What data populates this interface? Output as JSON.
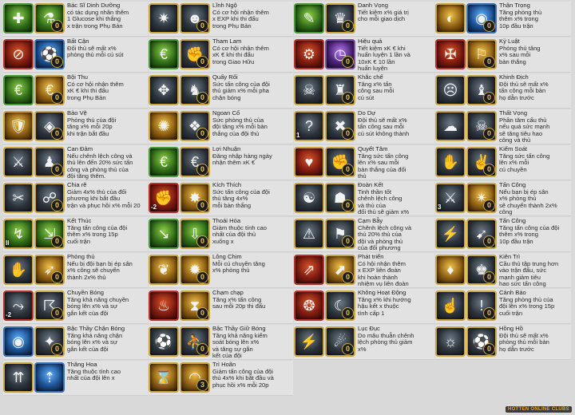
{
  "columns": [
    [
      {
        "name": "Bác Sĩ Dinh Dưỡng",
        "desc": "có tác dụng nhân thêm\n1 Glucose khi thắng\nx trận trong Phụ Bản",
        "icons": [
          {
            "id": "medicine-icon",
            "glyph": "✚",
            "frame": "green",
            "fill": "f-green"
          },
          {
            "id": "flask-icon",
            "glyph": "⚗",
            "frame": "gold",
            "fill": "f-green",
            "badge": "0"
          }
        ]
      },
      {
        "name": "Bất Cận",
        "desc": "Đối thủ sẽ mất x%\nphòng thủ mỗi cú sút",
        "icons": [
          {
            "id": "stop-ball-icon",
            "glyph": "⊘",
            "frame": "red",
            "fill": "f-red"
          },
          {
            "id": "ball-icon",
            "glyph": "⚽",
            "frame": "blue",
            "fill": "f-blue",
            "badge": "0"
          }
        ]
      },
      {
        "name": "Bội Thu",
        "desc": "Có cơ hội nhận thêm\nxK € khi thi đấu\ntrong Phụ Bản",
        "icons": [
          {
            "id": "money-bag-icon",
            "glyph": "€",
            "frame": "green",
            "fill": "f-green"
          },
          {
            "id": "coin-pile-icon",
            "glyph": "€",
            "frame": "gold",
            "fill": "f-gold",
            "badge": "0"
          }
        ]
      },
      {
        "name": "Bảo Vệ",
        "desc": "Phòng thủ của đội\ntăng x% mỗi 20p\nkhi trận bắt đầu",
        "icons": [
          {
            "id": "defender-icon",
            "glyph": "🛡",
            "frame": "gold",
            "fill": "f-gold"
          },
          {
            "id": "shield-player-icon",
            "glyph": "◈",
            "frame": "gold",
            "fill": "",
            "badge": "0"
          }
        ]
      },
      {
        "name": "Can Đảm",
        "desc": "Nếu chênh lệch công và\nthủ lên đến 20% sức tấn\ncông và phòng thủ của\nđội tăng thêm.",
        "icons": [
          {
            "id": "brave-player-icon",
            "glyph": "⚔",
            "frame": "gold",
            "fill": ""
          },
          {
            "id": "team-icon",
            "glyph": "♟",
            "frame": "gold",
            "fill": "",
            "badge": "0"
          }
        ]
      },
      {
        "name": "Chia rẽ",
        "desc": "Giảm 4x% thủ của đối\nphương khi bắt đầu\ntrận và phục hồi x% mỗi 20",
        "icons": [
          {
            "id": "split-icon",
            "glyph": "✂",
            "frame": "gold",
            "fill": ""
          },
          {
            "id": "divided-team-icon",
            "glyph": "☍",
            "frame": "gold",
            "fill": "",
            "badge": "0"
          }
        ]
      },
      {
        "name": "Kết Thúc",
        "desc": "Tăng tấn công của đội\nthêm x% trong 15p\ncuối trận",
        "icons": [
          {
            "id": "finish-icon",
            "glyph": "↯",
            "frame": "gold",
            "fill": "f-green",
            "side": "II"
          },
          {
            "id": "end-strike-icon",
            "glyph": "⇲",
            "frame": "gold",
            "fill": "f-green",
            "badge": "0"
          }
        ]
      },
      {
        "name": "Phòng thủ",
        "desc": "Nếu bị đội bạn bị ép sân\nx% công sẽ chuyển\nthành 2x% thủ",
        "icons": [
          {
            "id": "block-icon",
            "glyph": "✋",
            "frame": "gold",
            "fill": ""
          },
          {
            "id": "kick-icon",
            "glyph": "➶",
            "frame": "gold",
            "fill": "f-gold",
            "badge": "0"
          }
        ]
      },
      {
        "name": "Chuyền Bóng",
        "desc": "Tăng khả năng chuyền\nbóng lên x% và sự\ngắn kết của đội",
        "icons": [
          {
            "id": "pass-icon",
            "glyph": "⤳",
            "frame": "red",
            "fill": "",
            "side": "-2"
          },
          {
            "id": "passer-icon",
            "glyph": "☈",
            "frame": "gold",
            "fill": "",
            "badge": "0"
          }
        ]
      },
      {
        "name": "Bậc Thầy Chặn Bóng",
        "desc": "Tăng khả năng chặn\nbóng lên x% và sự\ngắn kết của đội",
        "icons": [
          {
            "id": "block-master-icon",
            "glyph": "◉",
            "frame": "blue",
            "fill": "f-blue"
          },
          {
            "id": "goalkeeper-icon",
            "glyph": "✦",
            "frame": "gold",
            "fill": "",
            "badge": "0"
          }
        ]
      },
      {
        "name": "Thăng Hoa",
        "desc": "Tăng thuộc tính cao\nnhất của đội lên x",
        "icons": [
          {
            "id": "ascend-icon",
            "glyph": "⇈",
            "frame": "gold",
            "fill": ""
          },
          {
            "id": "glowing-arrows-icon",
            "glyph": "⇡",
            "frame": "blue",
            "fill": "f-blue"
          }
        ]
      }
    ],
    [
      {
        "name": "Lĩnh Ngộ",
        "desc": "Có cơ hội nhận thêm\nx EXP khi thi đấu\ntrong Phụ Bản",
        "icons": [
          {
            "id": "insight-icon",
            "glyph": "✷",
            "frame": "gold",
            "fill": ""
          },
          {
            "id": "mind-icon",
            "glyph": "☻",
            "frame": "gold",
            "fill": "",
            "badge": "0"
          }
        ]
      },
      {
        "name": "Tham Lam",
        "desc": "Có cơ hội nhận thêm\nxK € khi thi đấu\ntrong Giao Hữu",
        "icons": [
          {
            "id": "greed-icon",
            "glyph": "€",
            "frame": "green",
            "fill": "f-green"
          },
          {
            "id": "grab-coin-icon",
            "glyph": "✊",
            "frame": "gold",
            "fill": "",
            "badge": "0"
          }
        ]
      },
      {
        "name": "Quấy Rối",
        "desc": "Sức tấn công của đội\nthủ giảm x% mỗi pha\nchặn bóng",
        "icons": [
          {
            "id": "harass-icon",
            "glyph": "✥",
            "frame": "gold",
            "fill": ""
          },
          {
            "id": "disrupt-icon",
            "glyph": "♞",
            "frame": "gold",
            "fill": "",
            "badge": "0"
          }
        ]
      },
      {
        "name": "Ngoan Cố",
        "desc": "Sức phòng thủ của\nđội tăng x% mỗi bàn\nthắng của đội thủ",
        "icons": [
          {
            "id": "stubborn-icon",
            "glyph": "✺",
            "frame": "gold",
            "fill": "f-gold"
          },
          {
            "id": "stubborn-player-icon",
            "glyph": "❖",
            "frame": "gold",
            "fill": "",
            "badge": "0"
          }
        ]
      },
      {
        "name": "Lợi Nhuận",
        "desc": "Đăng nhập hàng ngày\nnhận thêm xK €",
        "icons": [
          {
            "id": "profit-icon",
            "glyph": "€",
            "frame": "green",
            "fill": "f-green"
          },
          {
            "id": "profit-chart-icon",
            "glyph": "€",
            "frame": "gold",
            "fill": "",
            "badge": "0"
          }
        ]
      },
      {
        "name": "Kích Thích",
        "desc": "Sức tấn công của đội\nthủ tăng 4x%\nmỗi bàn thắng",
        "icons": [
          {
            "id": "fist-icon",
            "glyph": "✊",
            "frame": "red",
            "fill": "f-red",
            "side": "-2"
          },
          {
            "id": "stimulate-icon",
            "glyph": "✸",
            "frame": "gold",
            "fill": "f-gold",
            "badge": "0"
          }
        ]
      },
      {
        "name": "Thoái Hóa",
        "desc": "Giảm thuộc tính cao\nnhất của đội thủ\nxuống x",
        "icons": [
          {
            "id": "decay-icon",
            "glyph": "↘",
            "frame": "green",
            "fill": "f-green"
          },
          {
            "id": "downgrade-icon",
            "glyph": "⇩",
            "frame": "gold",
            "fill": "f-green",
            "badge": "0"
          }
        ]
      },
      {
        "name": "Lông Chim",
        "desc": "Mỗi cú chuyền tăng\nx% phòng thủ",
        "icons": [
          {
            "id": "feather-icon",
            "glyph": "❦",
            "frame": "gold",
            "fill": "f-gold"
          },
          {
            "id": "burst-icon",
            "glyph": "✹",
            "frame": "gold",
            "fill": "f-gold",
            "badge": "0"
          }
        ]
      },
      {
        "name": "Chạm chạp",
        "desc": "Tăng x% tấn công\nsau mỗi 20p thi đấu",
        "icons": [
          {
            "id": "slow-icon",
            "glyph": "♨",
            "frame": "red",
            "fill": "f-red"
          },
          {
            "id": "hourglass-icon",
            "glyph": "⧗",
            "frame": "gold",
            "fill": "f-gold",
            "badge": "0"
          }
        ]
      },
      {
        "name": "Bậc Thầy Giữ Bóng",
        "desc": "Tăng khả năng kiểm\nsoát bóng lên x%\nvà tăng sự gắn\nkết của đội",
        "icons": [
          {
            "id": "ball-control-icon",
            "glyph": "⚽",
            "frame": "gold",
            "fill": ""
          },
          {
            "id": "dribbler-icon",
            "glyph": "⛹",
            "frame": "gold",
            "fill": "",
            "badge": "0"
          }
        ]
      },
      {
        "name": "Trì Hoãn",
        "desc": "Giảm tấn công của đội\nthủ 4x% khi bắt đầu và\nphục hồi x% mỗi 20p",
        "icons": [
          {
            "id": "delay-icon",
            "glyph": "⌛",
            "frame": "gold",
            "fill": "f-gold"
          },
          {
            "id": "shell-icon",
            "glyph": "◠",
            "frame": "gold",
            "fill": "f-gold",
            "badge": "3"
          }
        ]
      }
    ],
    [
      {
        "name": "Danh Vọng",
        "desc": "Tiết kiệm x% giá trị\ncho mỗi giao dịch",
        "icons": [
          {
            "id": "fame-icon",
            "glyph": "✎",
            "frame": "green",
            "fill": "f-green"
          },
          {
            "id": "trophy-icon",
            "glyph": "♛",
            "frame": "gold",
            "fill": "",
            "badge": "0"
          }
        ]
      },
      {
        "name": "Hiệu quả",
        "desc": "Tiết kiệm xK € khi\nhuấn luyện 1 lần và\n10xK € 10 lần\nhuấn luyện",
        "icons": [
          {
            "id": "efficiency-icon",
            "glyph": "⚙",
            "frame": "red",
            "fill": "f-red"
          },
          {
            "id": "clock-icon",
            "glyph": "◷",
            "frame": "purple",
            "fill": "f-purple",
            "badge": "0"
          }
        ]
      },
      {
        "name": "Khắc chế",
        "desc": "Tăng x% tấn\ncông sau mỗi\ncú sút",
        "icons": [
          {
            "id": "counter-icon",
            "glyph": "☠",
            "frame": "gold",
            "fill": ""
          },
          {
            "id": "counter-player-icon",
            "glyph": "♜",
            "frame": "gold",
            "fill": "",
            "badge": "0"
          }
        ]
      },
      {
        "name": "Do Dự",
        "desc": "Đội thủ sẽ mất x%\ntấn công sau mỗi\ncú sút không thành",
        "icons": [
          {
            "id": "hesitate-icon",
            "glyph": "?",
            "frame": "gold",
            "fill": "",
            "side": "1"
          },
          {
            "id": "confused-icon",
            "glyph": "✖",
            "frame": "gold",
            "fill": "",
            "badge": "0"
          }
        ]
      },
      {
        "name": "Quyết Tâm",
        "desc": "Tăng sức tấn công\nlên x% sau mỗi\nbàn thắng của đối\nthủ",
        "icons": [
          {
            "id": "broken-heart-icon",
            "glyph": "♥",
            "frame": "gold",
            "fill": "f-red"
          },
          {
            "id": "determined-icon",
            "glyph": "✊",
            "frame": "gold",
            "fill": "",
            "badge": "0"
          }
        ]
      },
      {
        "name": "Đoàn Kết",
        "desc": "Tinh thần tốt\nchênh lệch công\nvà thủ của\nđối thủ sẽ giảm x%",
        "icons": [
          {
            "id": "unity-icon",
            "glyph": "☯",
            "frame": "gold",
            "fill": ""
          },
          {
            "id": "huddle-icon",
            "glyph": "☗",
            "frame": "gold",
            "fill": "",
            "badge": "0"
          }
        ]
      },
      {
        "name": "Cạm Bẫy",
        "desc": "Chênh lệch công và\nthủ 20% thủ của\nđội và phòng thủ\ncủa đối phương\nsẽ bị giảm",
        "icons": [
          {
            "id": "trap-icon",
            "glyph": "⚠",
            "frame": "gold",
            "fill": ""
          },
          {
            "id": "trap-player-icon",
            "glyph": "⚑",
            "frame": "gold",
            "fill": "",
            "badge": "0"
          }
        ]
      },
      {
        "name": "Phát triển",
        "desc": "Có hội nhận thêm\nx EXP liên đoàn\nkhi hoàn thành\nnhiệm vụ liên đoàn",
        "icons": [
          {
            "id": "growth-icon",
            "glyph": "⇗",
            "frame": "red",
            "fill": "f-red"
          },
          {
            "id": "growth-chart-icon",
            "glyph": "⬈",
            "frame": "gold",
            "fill": "f-gold",
            "badge": "0"
          }
        ]
      },
      {
        "name": "Không Hoạt Động",
        "desc": "Tăng x% khi hướng\nhậu kết x thuộc\ntính cấp 1",
        "icons": [
          {
            "id": "inactive-icon",
            "glyph": "❂",
            "frame": "red",
            "fill": "f-red"
          },
          {
            "id": "sleep-player-icon",
            "glyph": "☾",
            "frame": "gold",
            "fill": "",
            "badge": "0"
          }
        ]
      },
      {
        "name": "Lục Đục",
        "desc": "Do mâu thuẫn chênh\nlệch phòng thủ giảm\nx%",
        "icons": [
          {
            "id": "conflict-icon",
            "glyph": "⚡",
            "frame": "gold",
            "fill": ""
          },
          {
            "id": "argue-icon",
            "glyph": "☄",
            "frame": "gold",
            "fill": "",
            "badge": "0"
          }
        ]
      }
    ],
    [
      {
        "name": "Thận Trọng",
        "desc": "Tăng phòng thủ\nthêm x% trong\n10p đầu trận",
        "icons": [
          {
            "id": "caution-icon",
            "glyph": "◐",
            "frame": "gold",
            "fill": "f-gold"
          },
          {
            "id": "eye-icon",
            "glyph": "◉",
            "frame": "blue",
            "fill": "f-blue",
            "badge": "0"
          }
        ]
      },
      {
        "name": "Kỷ Luật",
        "desc": "Phòng thủ tăng\nx% sau mỗi\nbàn thắng",
        "icons": [
          {
            "id": "discipline-icon",
            "glyph": "✠",
            "frame": "red",
            "fill": "f-red"
          },
          {
            "id": "whistle-icon",
            "glyph": "⚐",
            "frame": "gold",
            "fill": "f-gold",
            "badge": "0"
          }
        ]
      },
      {
        "name": "Khinh Địch",
        "desc": "Đội thủ sẽ mất x%\ntấn công mỗi bàn\nhọ dẫn trước",
        "icons": [
          {
            "id": "scorn-icon",
            "glyph": "☹",
            "frame": "gold",
            "fill": ""
          },
          {
            "id": "scorn-player-icon",
            "glyph": "♝",
            "frame": "gold",
            "fill": "",
            "badge": "0"
          }
        ]
      },
      {
        "name": "Thất Vọng",
        "desc": "Phần tăm cấu thủ\nnếu quá sức mạnh\nsẽ tăng tiêu hao\ncông và thủ",
        "icons": [
          {
            "id": "despair-icon",
            "glyph": "☁",
            "frame": "gold",
            "fill": ""
          },
          {
            "id": "skull-icon",
            "glyph": "☠",
            "frame": "gold",
            "fill": "",
            "badge": "0"
          }
        ]
      },
      {
        "name": "Kiểm Soát",
        "desc": "Tăng sức tấn công\nlên x% mỗi\ncú chuyền",
        "icons": [
          {
            "id": "control-hand-icon",
            "glyph": "✋",
            "frame": "gold",
            "fill": ""
          },
          {
            "id": "hold-icon",
            "glyph": "✌",
            "frame": "gold",
            "fill": "",
            "badge": "0"
          }
        ]
      },
      {
        "name": "Tấn Công",
        "desc": "Nếu bạn bị ép sân\nx% phòng thủ\nsẽ chuyển thành 2x%\ncông",
        "icons": [
          {
            "id": "attack-icon",
            "glyph": "⚔",
            "frame": "gold",
            "fill": "",
            "side": "3"
          },
          {
            "id": "strike-icon",
            "glyph": "✴",
            "frame": "gold",
            "fill": "f-gold",
            "badge": "0"
          }
        ]
      },
      {
        "name": "Tấn Công",
        "desc": "Tăng tấn công của đội\nthêm x% trong\n10p đầu trận",
        "icons": [
          {
            "id": "attack-start-icon",
            "glyph": "⚡",
            "frame": "gold",
            "fill": ""
          },
          {
            "id": "charge-icon",
            "glyph": "➹",
            "frame": "gold",
            "fill": "",
            "badge": "0"
          }
        ]
      },
      {
        "name": "Kiên Trì",
        "desc": "Cầu thủ tập trung hơn\nvào trận đấu, sức\nmạnh giảm tiêu\nhao sức tấn công",
        "icons": [
          {
            "id": "persist-icon",
            "glyph": "♦",
            "frame": "gold",
            "fill": "f-gold"
          },
          {
            "id": "firm-player-icon",
            "glyph": "♚",
            "frame": "gold",
            "fill": "",
            "badge": "0"
          }
        ]
      },
      {
        "name": "Cảnh Báo",
        "desc": "Tăng phòng thủ của\nđội lên x% trong 15p\ncuối trận",
        "icons": [
          {
            "id": "warning-icon",
            "glyph": "☝",
            "frame": "gold",
            "fill": ""
          },
          {
            "id": "alert-icon",
            "glyph": "!",
            "frame": "gold",
            "fill": "",
            "badge": "0"
          }
        ]
      },
      {
        "name": "Hồng Hồ",
        "desc": "Đội thủ sẽ mất x%\nphòng thủ mỗi bàn\nhọ dẫn trước",
        "icons": [
          {
            "id": "fox-icon",
            "glyph": "☼",
            "frame": "gold",
            "fill": ""
          },
          {
            "id": "scorer-icon",
            "glyph": "⚽",
            "frame": "gold",
            "fill": "",
            "badge": "0"
          }
        ]
      }
    ]
  ],
  "watermark": "HOTTEN ONLINE CLUBS"
}
